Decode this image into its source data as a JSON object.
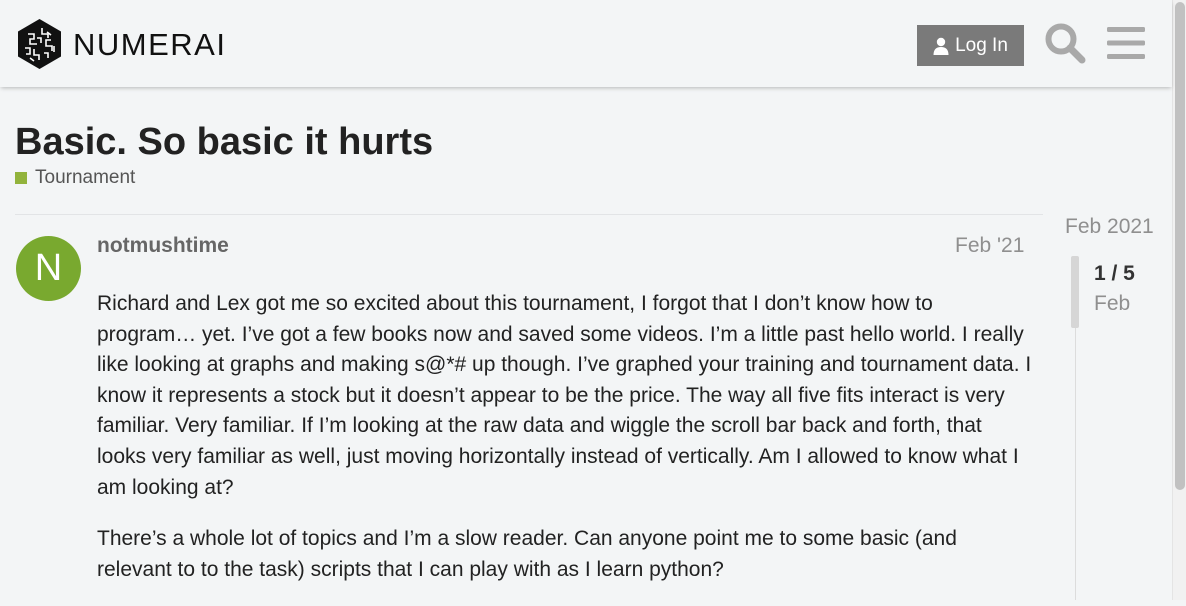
{
  "header": {
    "logo_text": "NUMERAI",
    "login_label": "Log In",
    "search_icon": "search-icon",
    "menu_icon": "hamburger-menu-icon"
  },
  "topic": {
    "title": "Basic. So basic it hurts",
    "category": "Tournament",
    "category_color": "#92b33c"
  },
  "post": {
    "avatar_letter": "N",
    "avatar_color": "#79a92f",
    "username": "notmushtime",
    "date": "Feb '21",
    "paragraphs": [
      "Richard and Lex got me so excited about this tournament, I forgot that I don’t know how to program… yet. I’ve got a few books now and saved some videos. I’m a little past hello world. I really like looking at graphs and making s@*# up though. I’ve graphed your training and tournament data. I know it represents a stock but it doesn’t appear to be the price. The way all five fits interact is very familiar. Very familiar. If I’m looking at the raw data and wiggle the scroll bar back and forth, that looks very familiar as well, just moving horizontally instead of vertically. Am I allowed to know what I am looking at?",
      "There’s a whole lot of topics and I’m a slow reader. Can anyone point me to some basic (and relevant to to the task) scripts that I can play with as I learn python?"
    ]
  },
  "timeline": {
    "start_date": "Feb 2021",
    "count": "1 / 5",
    "current_date": "Feb"
  }
}
